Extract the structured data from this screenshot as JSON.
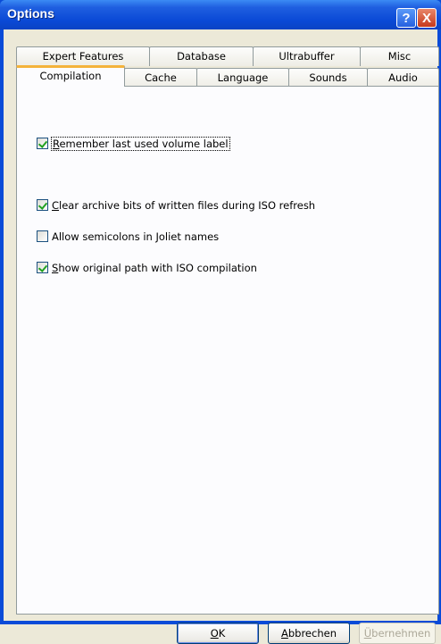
{
  "window": {
    "title": "Options"
  },
  "titlebar": {
    "help_glyph": "?",
    "close_glyph": "X"
  },
  "tabs": {
    "row1": [
      "Expert Features",
      "Database",
      "Ultrabuffer",
      "Misc"
    ],
    "row2": [
      "Compilation",
      "Cache",
      "Language",
      "Sounds",
      "Audio"
    ],
    "active": "Compilation"
  },
  "options": [
    {
      "label": "Remember last used volume label",
      "checked": true,
      "accel_first": "R",
      "label_rest": "emember last used volume label"
    },
    {
      "label": "Clear archive bits of written files during ISO refresh",
      "checked": true,
      "accel_first": "C",
      "label_rest": "lear archive bits of written files during ISO refresh"
    },
    {
      "label": "Allow semicolons in Joliet names",
      "checked": false,
      "accel_first": "",
      "label_rest": "Allow semicolons in Joliet names"
    },
    {
      "label": "Show original path with ISO compilation",
      "checked": true,
      "accel_first": "S",
      "label_rest": "how original path with ISO compilation"
    }
  ],
  "buttons": {
    "ok": {
      "accel": "O",
      "rest": "K"
    },
    "cancel": {
      "accel": "A",
      "rest": "bbrechen"
    },
    "apply": {
      "accel": "Ü",
      "rest": "bernehmen",
      "disabled": true
    }
  },
  "icons": {
    "help": "help-icon",
    "close": "close-icon",
    "checkbox": "checkbox-icon"
  }
}
